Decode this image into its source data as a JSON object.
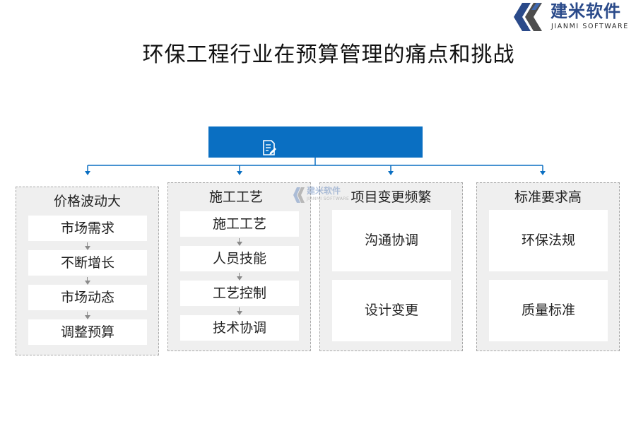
{
  "logo": {
    "name_cn": "建米软件",
    "name_en": "JIANMI SOFTWARE",
    "color": "#2a4a8a"
  },
  "watermark": {
    "name_cn": "建米软件",
    "name_en": "JIANMI SOFTWARE"
  },
  "title": "环保工程行业在预算管理的痛点和挑战",
  "root": {
    "icon": "document-edit-icon",
    "color": "#0a6fc2"
  },
  "categories": [
    {
      "title": "价格波动大",
      "items": [
        "市场需求",
        "不断增长",
        "市场动态",
        "调整预算"
      ],
      "flow": true
    },
    {
      "title": "施工工艺",
      "items": [
        "施工工艺",
        "人员技能",
        "工艺控制",
        "技术协调"
      ],
      "flow": true
    },
    {
      "title": "项目变更频繁",
      "items": [
        "沟通协调",
        "设计变更"
      ],
      "flow": false
    },
    {
      "title": "标准要求高",
      "items": [
        "环保法规",
        "质量标准"
      ],
      "flow": false
    }
  ]
}
